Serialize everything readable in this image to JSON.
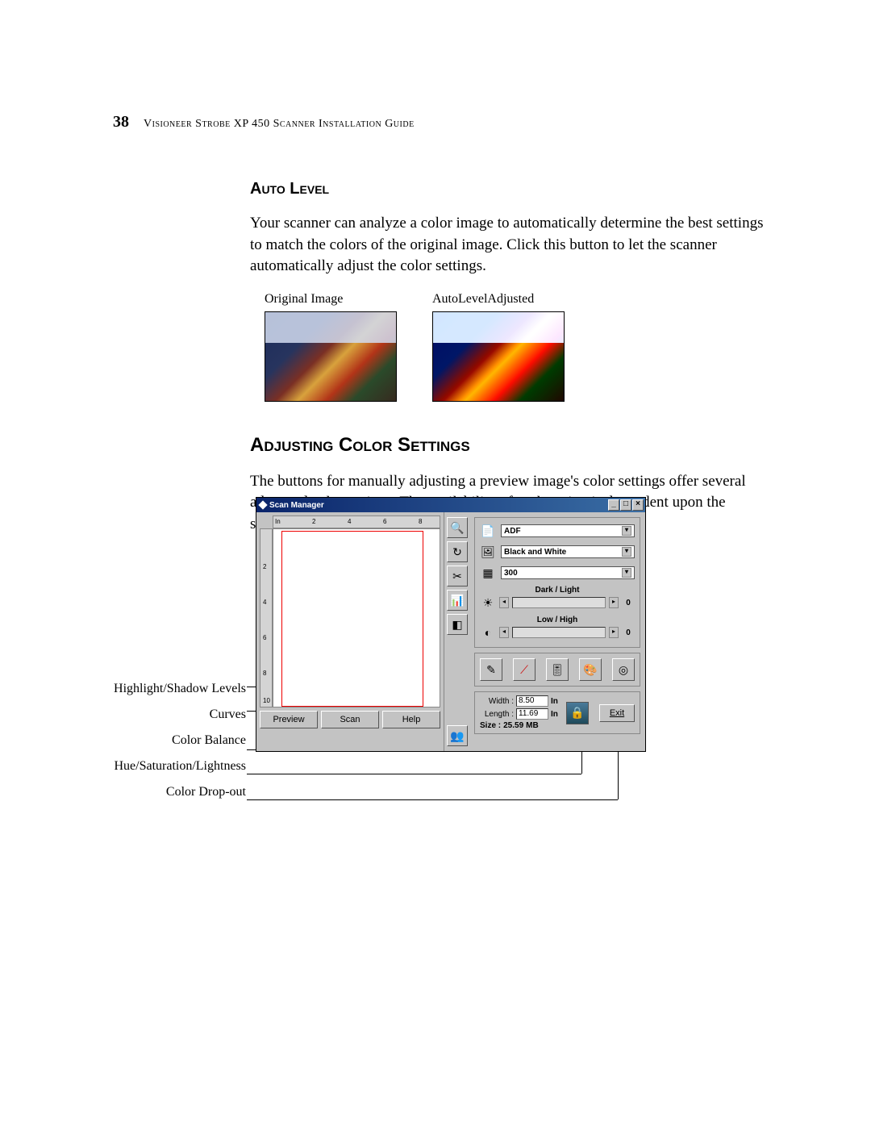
{
  "header": {
    "page_number": "38",
    "running_head": "Visioneer Strobe XP 450 Scanner Installation Guide"
  },
  "section1": {
    "heading": "Auto Level",
    "body": "Your scanner can analyze a color image to automatically determine the best settings to match the colors of the original image. Click this button to let the scanner automatically adjust the color settings.",
    "caption_original": "Original Image",
    "caption_adjusted": "AutoLevelAdjusted"
  },
  "section2": {
    "heading": "Adjusting Color Settings",
    "body": "The buttons for manually adjusting a preview image's color settings offer several advanced color options. The availability of each option is dependent upon the selected Image Type for the image."
  },
  "callouts": {
    "c1": "Highlight/Shadow Levels",
    "c2": "Curves",
    "c3": "Color Balance",
    "c4": "Hue/Saturation/Lightness",
    "c5": "Color Drop-out"
  },
  "scan_manager": {
    "title": "Scan Manager",
    "win_min": "_",
    "win_max": "□",
    "win_close": "×",
    "ruler_unit": "In",
    "ruler_marks_h": [
      "2",
      "4",
      "6",
      "8"
    ],
    "ruler_marks_v": [
      "2",
      "4",
      "6",
      "8",
      "10"
    ],
    "buttons": {
      "preview": "Preview",
      "scan": "Scan",
      "help": "Help"
    },
    "left_tools": [
      "zoom",
      "rotate",
      "crop",
      "levels",
      "eraser",
      "portrait"
    ],
    "settings": {
      "feeder_value": "ADF",
      "image_type_value": "Black and White",
      "resolution_value": "300",
      "brightness_label": "Dark / Light",
      "brightness_value": "0",
      "contrast_label": "Low / High",
      "contrast_value": "0"
    },
    "color_buttons": [
      "highlight-shadow",
      "curves",
      "color-balance",
      "hue-saturation",
      "color-dropout"
    ],
    "dims": {
      "width_label": "Width :",
      "width_value": "8.50",
      "length_label": "Length :",
      "length_value": "11.69",
      "unit": "In",
      "size_label": "Size :",
      "size_value": "25.59",
      "size_unit": "MB"
    },
    "exit": "Exit"
  }
}
